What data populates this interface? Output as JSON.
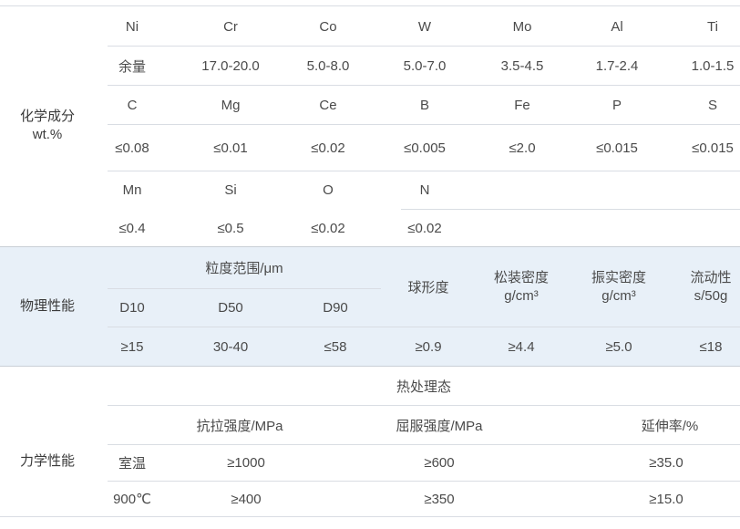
{
  "chemistry": {
    "label_line1": "化学成分",
    "label_line2": "wt.%",
    "row1_elements": [
      "Ni",
      "Cr",
      "Co",
      "W",
      "Mo",
      "Al",
      "Ti"
    ],
    "row1_values": [
      "余量",
      "17.0-20.0",
      "5.0-8.0",
      "5.0-7.0",
      "3.5-4.5",
      "1.7-2.4",
      "1.0-1.5"
    ],
    "row2_elements": [
      "C",
      "Mg",
      "Ce",
      "B",
      "Fe",
      "P",
      "S"
    ],
    "row2_values": [
      "≤0.08",
      "≤0.01",
      "≤0.02",
      "≤0.005",
      "≤2.0",
      "≤0.015",
      "≤0.015"
    ],
    "row3_elements": [
      "Mn",
      "Si",
      "O",
      "N"
    ],
    "row3_values": [
      "≤0.4",
      "≤0.5",
      "≤0.02",
      "≤0.02"
    ]
  },
  "physical": {
    "label": "物理性能",
    "particle_range_header": "粒度范围/μm",
    "d_headers": [
      "D10",
      "D50",
      "D90"
    ],
    "sphericity_header": "球形度",
    "bulk_density_header_line1": "松装密度",
    "bulk_density_header_line2": "g/cm³",
    "tap_density_header_line1": "振实密度",
    "tap_density_header_line2": "g/cm³",
    "flowability_header_line1": "流动性",
    "flowability_header_line2": "s/50g",
    "values": [
      "≥15",
      "30-40",
      "≤58",
      "≥0.9",
      "≥4.4",
      "≥5.0",
      "≤18"
    ]
  },
  "mechanical": {
    "label": "力学性能",
    "state_header": "热处理态",
    "column_headers": [
      "抗拉强度/MPa",
      "屈服强度/MPa",
      "延伸率/%"
    ],
    "rows": [
      {
        "condition": "室温",
        "tensile": "≥1000",
        "yield": "≥600",
        "elongation": "≥35.0"
      },
      {
        "condition": "900℃",
        "tensile": "≥400",
        "yield": "≥350",
        "elongation": "≥15.0"
      }
    ]
  }
}
